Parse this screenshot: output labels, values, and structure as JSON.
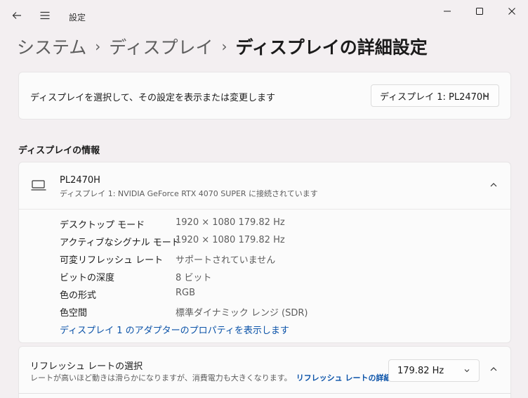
{
  "titlebar": {
    "app_title": "設定",
    "back_icon": "back-arrow-icon",
    "menu_icon": "hamburger-menu-icon"
  },
  "window_controls": [
    "minimize-icon",
    "maximize-icon",
    "close-icon"
  ],
  "breadcrumb": {
    "items": [
      "システム",
      "ディスプレイ"
    ],
    "current": "ディスプレイの詳細設定"
  },
  "display_select": {
    "label": "ディスプレイを選択して、その設定を表示または変更します",
    "value": "ディスプレイ 1: PL2470H"
  },
  "info_section": {
    "title": "ディスプレイの情報",
    "monitor_name": "PL2470H",
    "monitor_sub": "ディスプレイ 1: NVIDIA GeForce RTX 4070 SUPER に接続されています",
    "rows": [
      {
        "key": "デスクトップ モード",
        "value": "1920 × 1080 179.82 Hz"
      },
      {
        "key": "アクティブなシグナル モード",
        "value": "1920 × 1080 179.82 Hz"
      },
      {
        "key": "可変リフレッシュ レート",
        "value": "サポートされていません"
      },
      {
        "key": "ビットの深度",
        "value": "8 ビット"
      },
      {
        "key": "色の形式",
        "value": "RGB"
      },
      {
        "key": "色空間",
        "value": "標準ダイナミック レンジ (SDR)"
      }
    ],
    "adapter_link": "ディスプレイ 1 のアダプターのプロパティを表示します"
  },
  "refresh": {
    "title": "リフレッシュ レートの選択",
    "subtitle": "レートが高いほど動きは滑らかになりますが、消費電力も大きくなります。",
    "link": "リフレッシュ レートの詳細",
    "value": "179.82 Hz"
  },
  "colors": {
    "background": "#f3eff1",
    "card": "#fbfbfb",
    "link": "#0a52a8"
  }
}
